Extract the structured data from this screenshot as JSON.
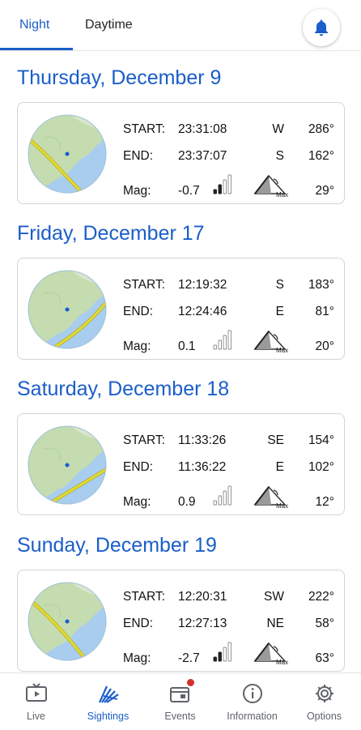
{
  "tabs": {
    "night": "Night",
    "daytime": "Daytime",
    "active": "night"
  },
  "colors": {
    "accent": "#1a5ec9",
    "map_water": "#a9cdee",
    "map_land": "#c4dcb0",
    "track": "#e2d934"
  },
  "labels": {
    "start": "START:",
    "end": "END:",
    "mag": "Mag:",
    "max": "Max"
  },
  "sightings": [
    {
      "date": "Thursday, December 9",
      "start_time": "23:31:08",
      "start_dir": "W",
      "start_deg": "286°",
      "end_time": "23:37:07",
      "end_dir": "S",
      "end_deg": "162°",
      "mag": "-0.7",
      "max_elev": "29°",
      "signal_level": 2
    },
    {
      "date": "Friday, December 17",
      "start_time": "12:19:32",
      "start_dir": "S",
      "start_deg": "183°",
      "end_time": "12:24:46",
      "end_dir": "E",
      "end_deg": "81°",
      "mag": "0.1",
      "max_elev": "20°",
      "signal_level": 0
    },
    {
      "date": "Saturday, December 18",
      "start_time": "11:33:26",
      "start_dir": "SE",
      "start_deg": "154°",
      "end_time": "11:36:22",
      "end_dir": "E",
      "end_deg": "102°",
      "mag": "0.9",
      "max_elev": "12°",
      "signal_level": 0
    },
    {
      "date": "Sunday, December 19",
      "start_time": "12:20:31",
      "start_dir": "SW",
      "start_deg": "222°",
      "end_time": "12:27:13",
      "end_dir": "NE",
      "end_deg": "58°",
      "mag": "-2.7",
      "max_elev": "63°",
      "signal_level": 2
    }
  ],
  "bottom_nav": [
    {
      "label": "Live",
      "icon": "tv-play-icon",
      "active": false
    },
    {
      "label": "Sightings",
      "icon": "satellite-icon",
      "active": true
    },
    {
      "label": "Events",
      "icon": "calendar-icon",
      "active": false,
      "badge": true
    },
    {
      "label": "Information",
      "icon": "info-icon",
      "active": false
    },
    {
      "label": "Options",
      "icon": "gear-icon",
      "active": false
    }
  ]
}
